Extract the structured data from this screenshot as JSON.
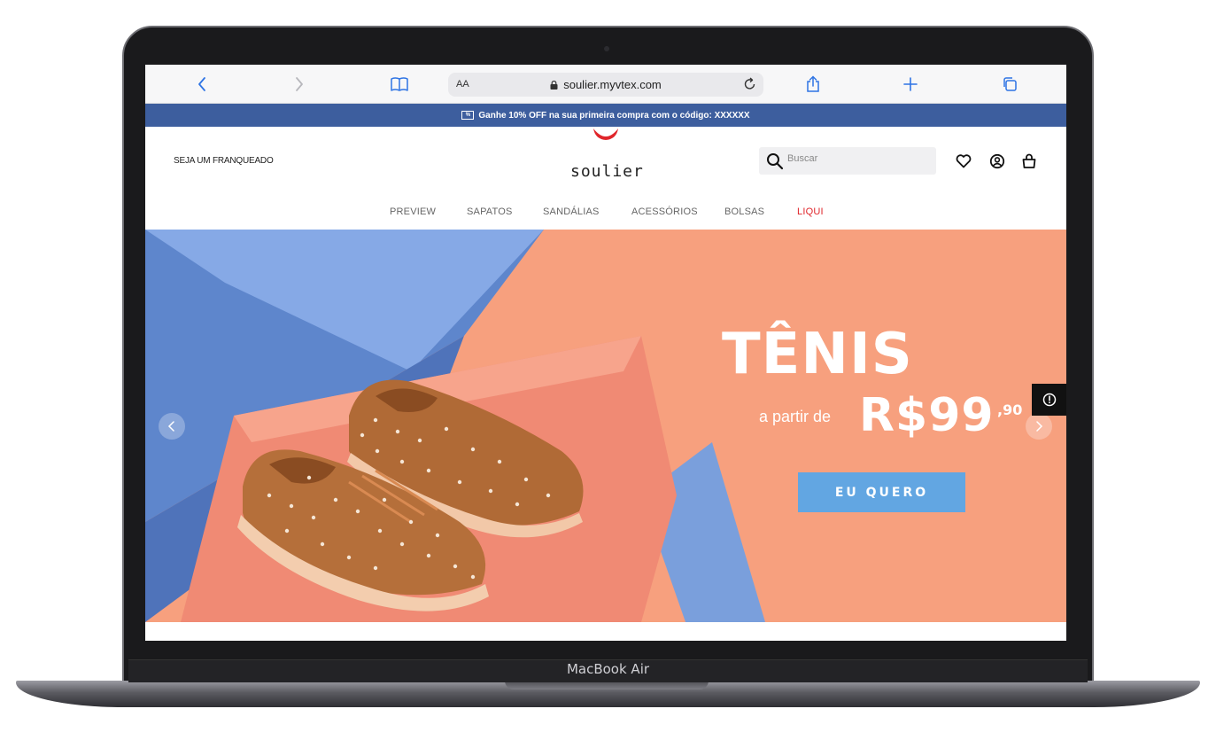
{
  "device": {
    "label": "MacBook Air"
  },
  "browser": {
    "text_size_label": "AA",
    "url": "soulier.myvtex.com"
  },
  "promo": {
    "icon_text": "%",
    "text": "Ganhe 10% OFF na sua primeira compra com o código: XXXXXX"
  },
  "header": {
    "franchise_link": "SEJA UM FRANQUEADO",
    "logo_text": "soulier",
    "search_placeholder": "Buscar"
  },
  "nav": {
    "items": [
      {
        "label": "PREVIEW"
      },
      {
        "label": "SAPATOS"
      },
      {
        "label": "SANDÁLIAS"
      },
      {
        "label": "ACESSÓRIOS"
      },
      {
        "label": "BOLSAS"
      },
      {
        "label": "LIQUI"
      }
    ]
  },
  "hero": {
    "title": "TÊNIS",
    "from_text": "a partir de",
    "price": "R$99",
    "cents": ",90",
    "cta_label": "EU QUERO"
  },
  "colors": {
    "promo_bar": "#3d5e9e",
    "accent_sale": "#e0262b",
    "cta": "#62a6e2",
    "hero_background": "#f7a07e",
    "browser_accent": "#2f74e4"
  }
}
